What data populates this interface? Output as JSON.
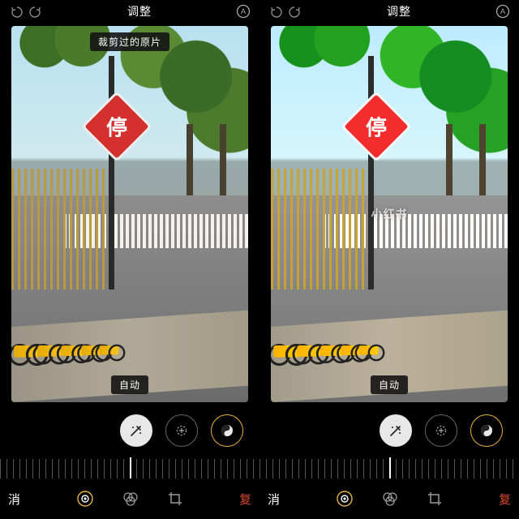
{
  "watermark": "小红书",
  "panes": [
    {
      "header": {
        "title": "调整",
        "markers_icon": "markers-icon"
      },
      "overlay_top": "裁剪过的原片",
      "overlay_bottom": "自动",
      "sign_char": "停",
      "tools": {
        "wand": "magic-wand-icon",
        "add": "add-icon",
        "yin": "yin-yang-icon",
        "selected": "yin"
      },
      "bottom": {
        "cancel": "消",
        "reset": "复",
        "tabs": [
          "adjust-icon",
          "filters-icon",
          "crop-icon"
        ],
        "active_tab": 0
      },
      "warm": false
    },
    {
      "header": {
        "title": "调整",
        "markers_icon": "markers-icon"
      },
      "overlay_top": "",
      "overlay_bottom": "自动",
      "sign_char": "停",
      "tools": {
        "wand": "magic-wand-icon",
        "add": "add-icon",
        "yin": "yin-yang-icon",
        "selected": "yin"
      },
      "bottom": {
        "cancel": "消",
        "reset": "复",
        "tabs": [
          "adjust-icon",
          "filters-icon",
          "crop-icon"
        ],
        "active_tab": 0
      },
      "warm": true
    }
  ]
}
